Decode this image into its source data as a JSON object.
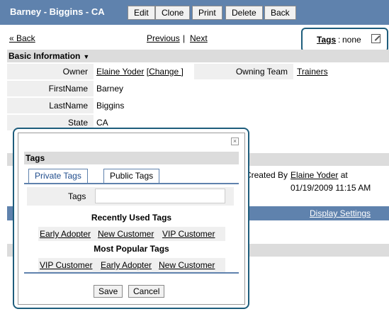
{
  "header": {
    "title": "Barney - Biggins - CA",
    "buttons": [
      "Edit",
      "Clone",
      "Print",
      "Delete",
      "Back"
    ]
  },
  "nav": {
    "back": "« Back",
    "previous": "Previous",
    "separator": "|",
    "next": "Next"
  },
  "tags": {
    "label": "Tags",
    "separator": ":",
    "value": "none"
  },
  "basic_info": {
    "header": "Basic Information",
    "owner_label": "Owner",
    "owner_value": "Elaine Yoder",
    "change_link": "[Change ]",
    "owning_team_label": "Owning Team",
    "owning_team_value": "Trainers",
    "firstname_label": "FirstName",
    "firstname_value": "Barney",
    "lastname_label": "LastName",
    "lastname_value": "Biggins",
    "state_label": "State",
    "state_value": "CA"
  },
  "background": {
    "created_by_label": "Created By",
    "created_by_value": "Elaine Yoder",
    "created_by_suffix": "at",
    "created_date": "01/19/2009 11:15 AM",
    "display_settings": "Display Settings"
  },
  "modal": {
    "title": "Tags",
    "tabs": [
      "Private Tags",
      "Public Tags"
    ],
    "tags_label": "Tags",
    "tags_input_value": "",
    "recent_header": "Recently Used Tags",
    "recent_tags": [
      "Early Adopter",
      "New Customer",
      "VIP Customer"
    ],
    "popular_header": "Most Popular Tags",
    "popular_tags": [
      "VIP Customer",
      "Early Adopter",
      "New Customer"
    ],
    "save": "Save",
    "cancel": "Cancel"
  },
  "colors": {
    "header_blue": "#5f82ad",
    "callout_border": "#1e5d7c",
    "section_gray": "#dcdcdc"
  }
}
